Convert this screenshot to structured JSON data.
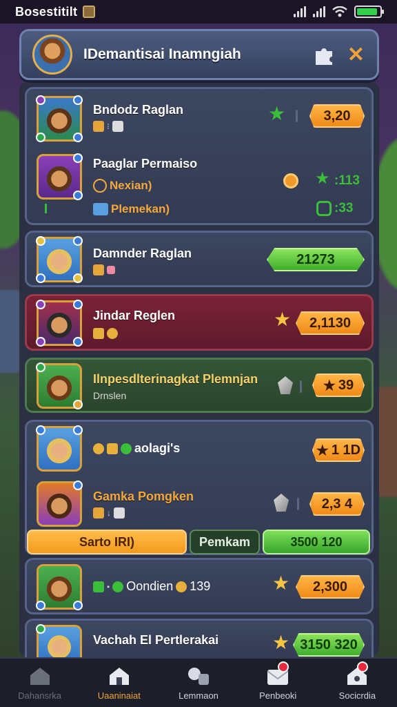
{
  "status_bar": {
    "title": "Bosestitilt",
    "battery_level": 0.9
  },
  "header": {
    "title": "IDemantisai Inamngiah",
    "icons": [
      "avatar",
      "puzzle-icon",
      "close-icon"
    ]
  },
  "entries": [
    {
      "name": "Bndodz Raglan",
      "sub_icons": [
        "barrel-icon",
        "dice-icon"
      ],
      "star_color": "#3bbf3b",
      "value": "3,20"
    },
    {
      "name": "Paaglar Permaiso",
      "line1": "Nexian)",
      "line2": "Plemekan)",
      "stat1": "113",
      "stat2": "33"
    },
    {
      "name": "Damnder Raglan",
      "value": "21273"
    },
    {
      "name": "Jindar Reglen",
      "value": "2,1130"
    },
    {
      "name": "Ilnpesdlterinagkat Plemnjan",
      "sub": "Drnslen",
      "value": "39"
    },
    {
      "name": "aolagi's",
      "value": "1 1D"
    },
    {
      "name": "Gamka Pomgken",
      "value": "2,3 4"
    },
    {
      "name": "Oondien",
      "count": "139",
      "value": "2,300"
    },
    {
      "name": "Vachah El Pertlerakai",
      "value": "3150 320"
    }
  ],
  "actions": {
    "primary": "Sarto IRI)",
    "secondary": "Pemkam",
    "tertiary": "3500 120"
  },
  "bottom_nav": [
    {
      "label": "Dahansrka",
      "icon": "home-icon",
      "state": "dim"
    },
    {
      "label": "Uaaninaiat",
      "icon": "house-icon",
      "state": "active"
    },
    {
      "label": "Lemmaon",
      "icon": "chat-icon",
      "state": "normal"
    },
    {
      "label": "Penbeoki",
      "icon": "mail-icon",
      "state": "normal",
      "badge": true
    },
    {
      "label": "Socicrdia",
      "icon": "shield-icon",
      "state": "normal",
      "badge": true
    }
  ],
  "colors": {
    "accent_orange": "#f08a18",
    "accent_green": "#3fae2e",
    "panel": "#323b52",
    "danger_card": "#5e1a2c",
    "success_card": "#2a442c"
  }
}
